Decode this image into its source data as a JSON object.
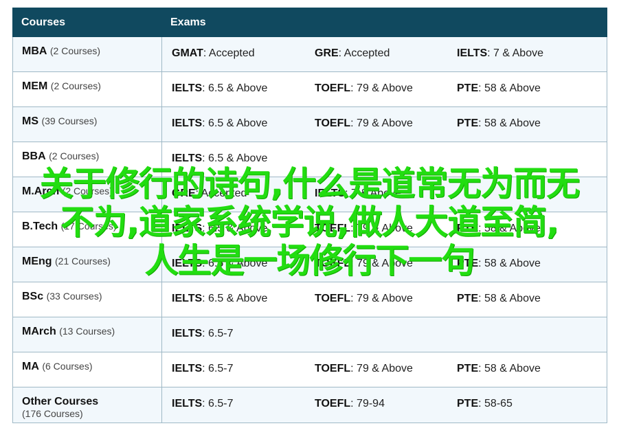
{
  "header": {
    "courses": "Courses",
    "exams": "Exams"
  },
  "rows": [
    {
      "name": "MBA",
      "count": "(2 Courses)",
      "exams": [
        {
          "name": "GMAT",
          "req": ": Accepted"
        },
        {
          "name": "GRE",
          "req": ": Accepted"
        },
        {
          "name": "IELTS",
          "req": ": 7 & Above"
        }
      ]
    },
    {
      "name": "MEM",
      "count": "(2 Courses)",
      "exams": [
        {
          "name": "IELTS",
          "req": ": 6.5 & Above"
        },
        {
          "name": "TOEFL",
          "req": ": 79 & Above"
        },
        {
          "name": "PTE",
          "req": ": 58 & Above"
        }
      ]
    },
    {
      "name": "MS",
      "count": "(39 Courses)",
      "exams": [
        {
          "name": "IELTS",
          "req": ": 6.5 & Above"
        },
        {
          "name": "TOEFL",
          "req": ": 79 & Above"
        },
        {
          "name": "PTE",
          "req": ": 58 & Above"
        }
      ]
    },
    {
      "name": "BBA",
      "count": "(2 Courses)",
      "exams": [
        {
          "name": "IELTS",
          "req": ": 6.5 & Above"
        }
      ]
    },
    {
      "name": "M.Arch",
      "count": "(2 Courses)",
      "exams": [
        {
          "name": "GRE",
          "req": ": Accepted"
        },
        {
          "name": "IELTS",
          "req": ": 7 & Above"
        }
      ]
    },
    {
      "name": "B.Tech",
      "count": "(17 Courses)",
      "exams": [
        {
          "name": "IELTS",
          "req": ": 6.5 & Above"
        },
        {
          "name": "TOEFL",
          "req": ": 79 & Above"
        },
        {
          "name": "PTE",
          "req": ": 58 & Above"
        }
      ]
    },
    {
      "name": "MEng",
      "count": "(21 Courses)",
      "exams": [
        {
          "name": "IELTS",
          "req": ": 6.5 & Above"
        },
        {
          "name": "TOEFL",
          "req": ": 79 & Above"
        },
        {
          "name": "PTE",
          "req": ": 58 & Above"
        }
      ]
    },
    {
      "name": "BSc",
      "count": "(33 Courses)",
      "exams": [
        {
          "name": "IELTS",
          "req": ": 6.5 & Above"
        },
        {
          "name": "TOEFL",
          "req": ": 79 & Above"
        },
        {
          "name": "PTE",
          "req": ": 58 & Above"
        }
      ]
    },
    {
      "name": "MArch",
      "count": "(13 Courses)",
      "exams": [
        {
          "name": "IELTS",
          "req": ": 6.5-7"
        }
      ]
    },
    {
      "name": "MA",
      "count": "(6 Courses)",
      "exams": [
        {
          "name": "IELTS",
          "req": ": 6.5-7"
        },
        {
          "name": "TOEFL",
          "req": ": 79 & Above"
        },
        {
          "name": "PTE",
          "req": ": 58 & Above"
        }
      ]
    },
    {
      "name": "Other Courses",
      "count": "(176 Courses)",
      "exams": [
        {
          "name": "IELTS",
          "req": ": 6.5-7"
        },
        {
          "name": "TOEFL",
          "req": ": 79-94"
        },
        {
          "name": "PTE",
          "req": ": 58-65"
        }
      ]
    }
  ],
  "overlay": {
    "line1": "关于修行的诗句,什么是道常无为而无",
    "line2": "不为,道家系统学说,做人大道至简,",
    "line3": "人生是一场修行下一句"
  },
  "colors": {
    "header_bg": "#10495f",
    "border": "#9fb8c6",
    "overlay_text": "#22dd11"
  }
}
